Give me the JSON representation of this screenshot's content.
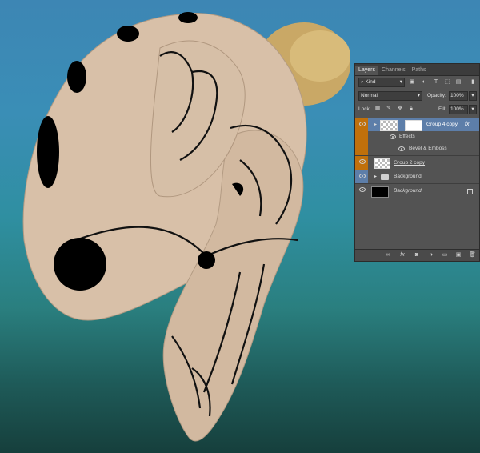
{
  "panel": {
    "tabs": [
      "Layers",
      "Channels",
      "Paths"
    ],
    "filter_kind": "Kind",
    "blend_mode": "Normal",
    "opacity_label": "Opacity:",
    "opacity_value": "100%",
    "lock_label": "Lock:",
    "fill_label": "Fill:",
    "fill_value": "100%",
    "layers": [
      {
        "name": "Group 4 copy",
        "fx": "fx",
        "selected": true
      },
      {
        "name": "Effects"
      },
      {
        "name": "Bevel & Emboss"
      },
      {
        "name": "Group 2 copy"
      },
      {
        "name": "Background",
        "type": "group"
      },
      {
        "name": "Background",
        "locked": true
      }
    ]
  },
  "icons": [
    "eye-icon",
    "folder-icon",
    "lock-icon",
    "link-icon",
    "fx-icon",
    "mask-icon",
    "adjustment-icon",
    "new-group-icon",
    "new-layer-icon",
    "trash-icon"
  ],
  "colors": {
    "selected_layer": "#5d7ea9",
    "eye_highlight": "#c0700b",
    "panel_bg": "#535353"
  }
}
